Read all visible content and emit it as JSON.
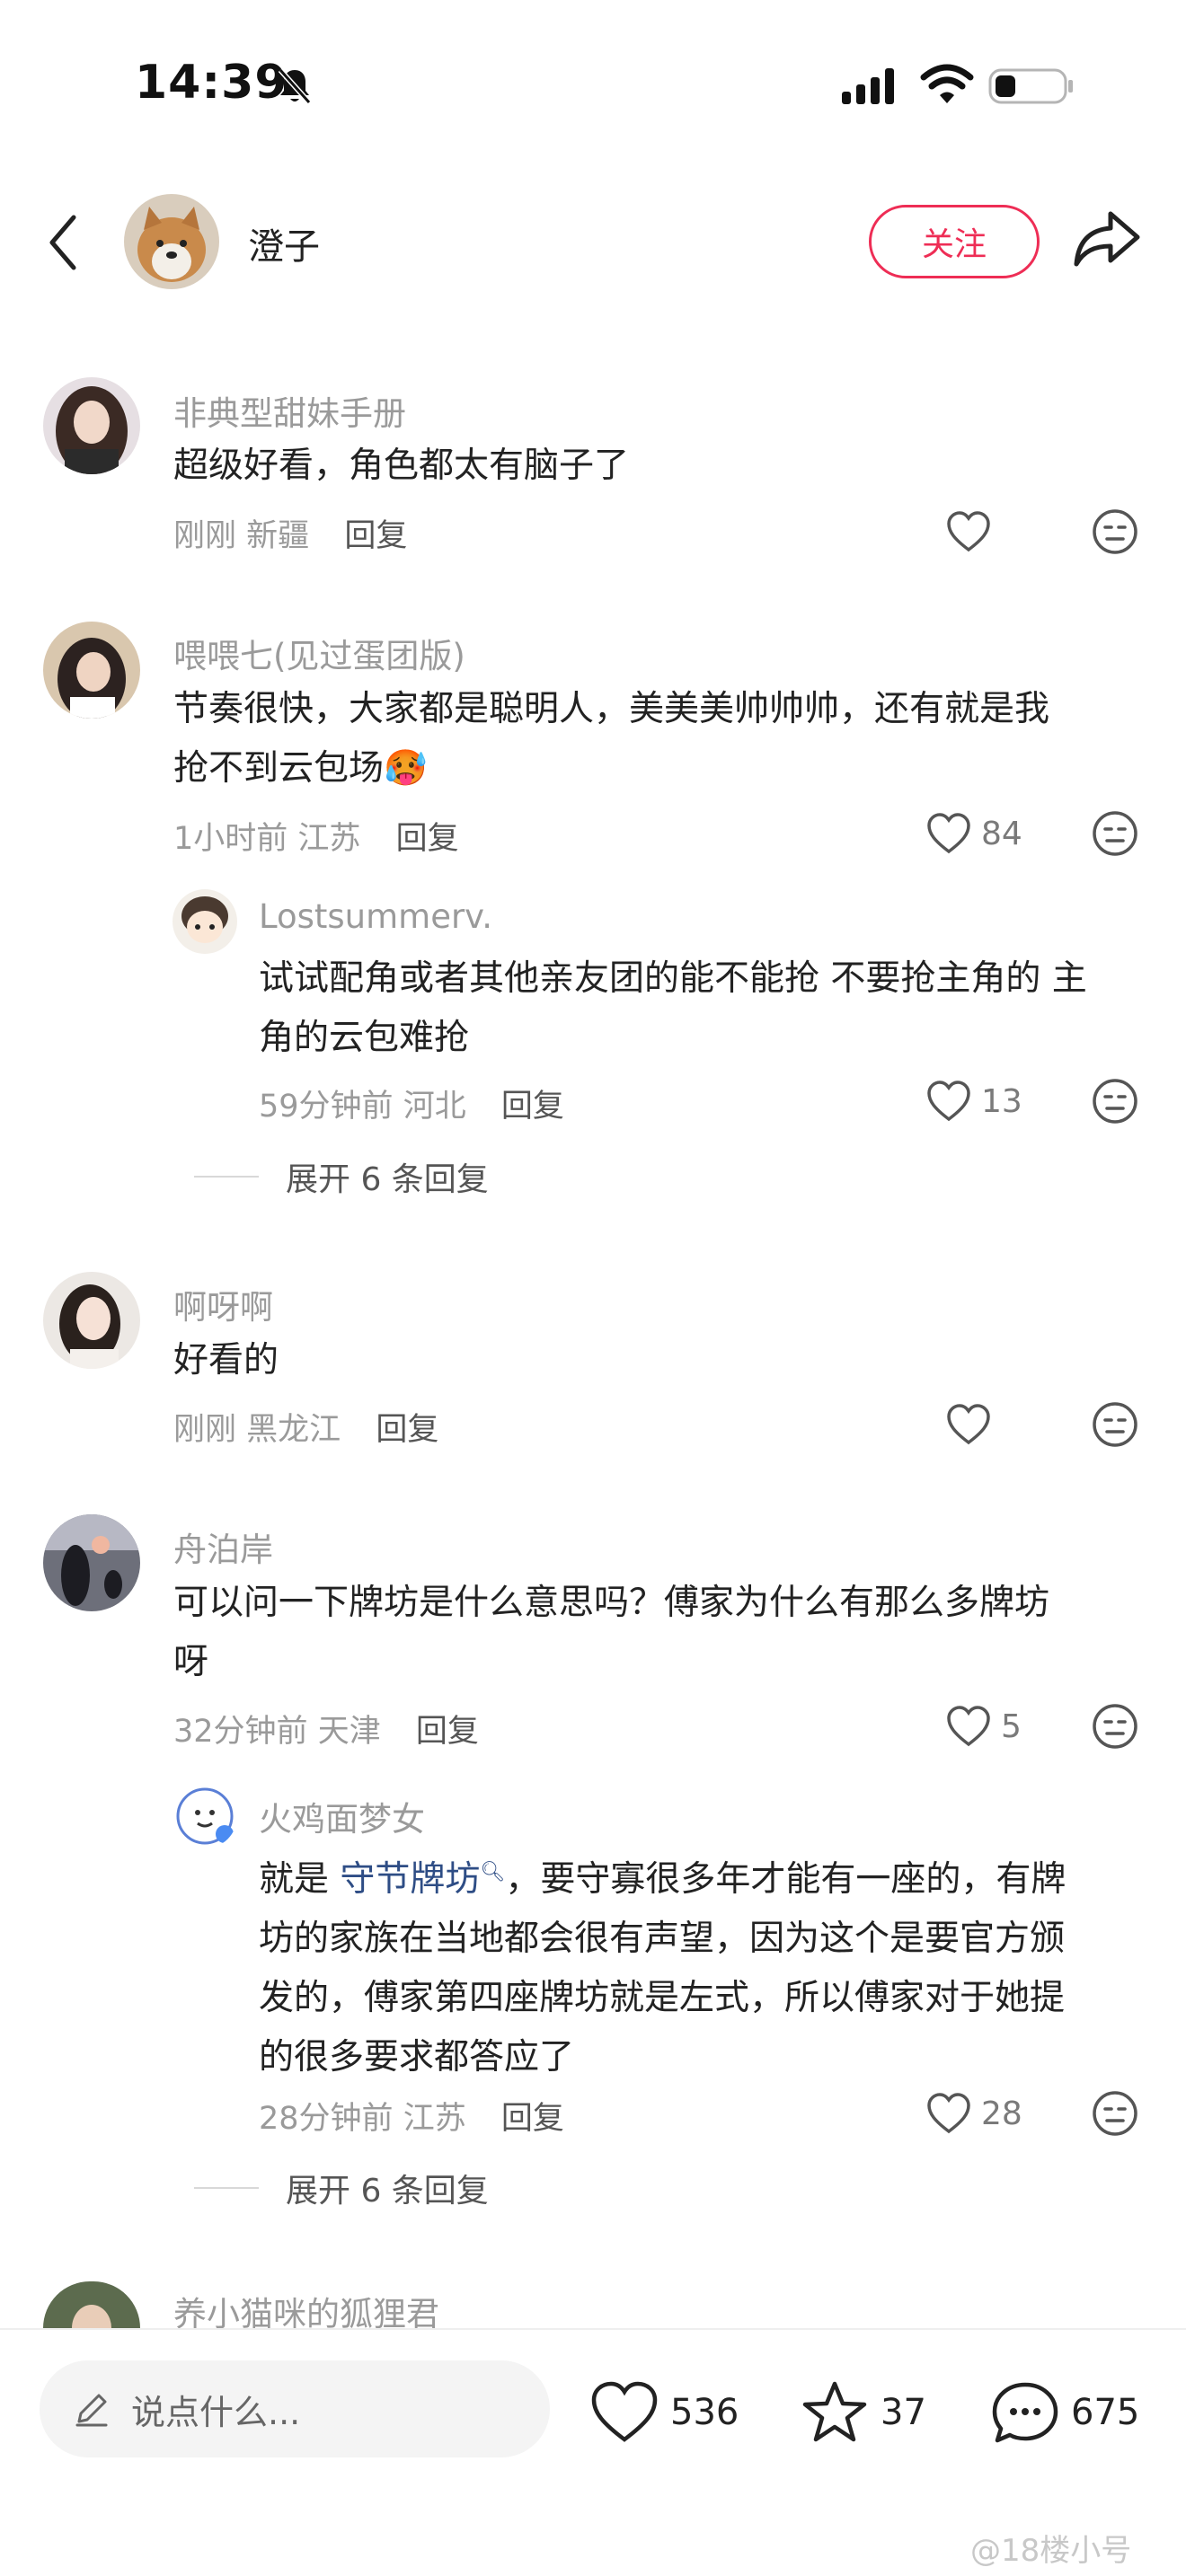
{
  "status_bar": {
    "time": "14:39"
  },
  "header": {
    "author_name": "澄子",
    "follow_label": "关注"
  },
  "comments": [
    {
      "username": "非典型甜妹手册",
      "content": "超级好看，角色都太有脑子了",
      "time": "刚刚",
      "location": "新疆",
      "reply_label": "回复",
      "likes": ""
    },
    {
      "username": "喂喂七(见过蛋团版)",
      "content_line1": "节奏很快，大家都是聪明人，美美美帅帅帅，还有就是我",
      "content_line2": "抢不到云包场",
      "emoji": "🥵",
      "time": "1小时前",
      "location": "江苏",
      "reply_label": "回复",
      "likes": "84",
      "reply": {
        "username": "Lostsummerv.",
        "content_line1": "试试配角或者其他亲友团的能不能抢 不要抢主角的 主",
        "content_line2": "角的云包难抢",
        "time": "59分钟前",
        "location": "河北",
        "reply_label": "回复",
        "likes": "13"
      },
      "expand_label": "展开 6 条回复"
    },
    {
      "username": "啊呀啊",
      "content": "好看的",
      "time": "刚刚",
      "location": "黑龙江",
      "reply_label": "回复",
      "likes": ""
    },
    {
      "username": "舟泊岸",
      "content_line1": "可以问一下牌坊是什么意思吗？傅家为什么有那么多牌坊",
      "content_line2": "呀",
      "time": "32分钟前",
      "location": "天津",
      "reply_label": "回复",
      "likes": "5",
      "reply": {
        "username": "火鸡面梦女",
        "content_prefix": "就是 ",
        "content_link": "守节牌坊",
        "content_rest1": "，要守寡很多年才能有一座的，有牌",
        "content_line2": "坊的家族在当地都会很有声望，因为这个是要官方颁",
        "content_line3": "发的，傅家第四座牌坊就是左式，所以傅家对于她提",
        "content_line4": "的很多要求都答应了",
        "time": "28分钟前",
        "location": "江苏",
        "reply_label": "回复",
        "likes": "28"
      },
      "expand_label": "展开 6 条回复"
    },
    {
      "username": "养小猫咪的狐狸君"
    }
  ],
  "bottom_bar": {
    "input_placeholder": "说点什么...",
    "likes": "536",
    "stars": "37",
    "comments": "675"
  },
  "watermark": "@18楼小号",
  "colors": {
    "accent": "#ee2d55",
    "link": "#2e4d85",
    "muted": "#9a9a9a"
  }
}
